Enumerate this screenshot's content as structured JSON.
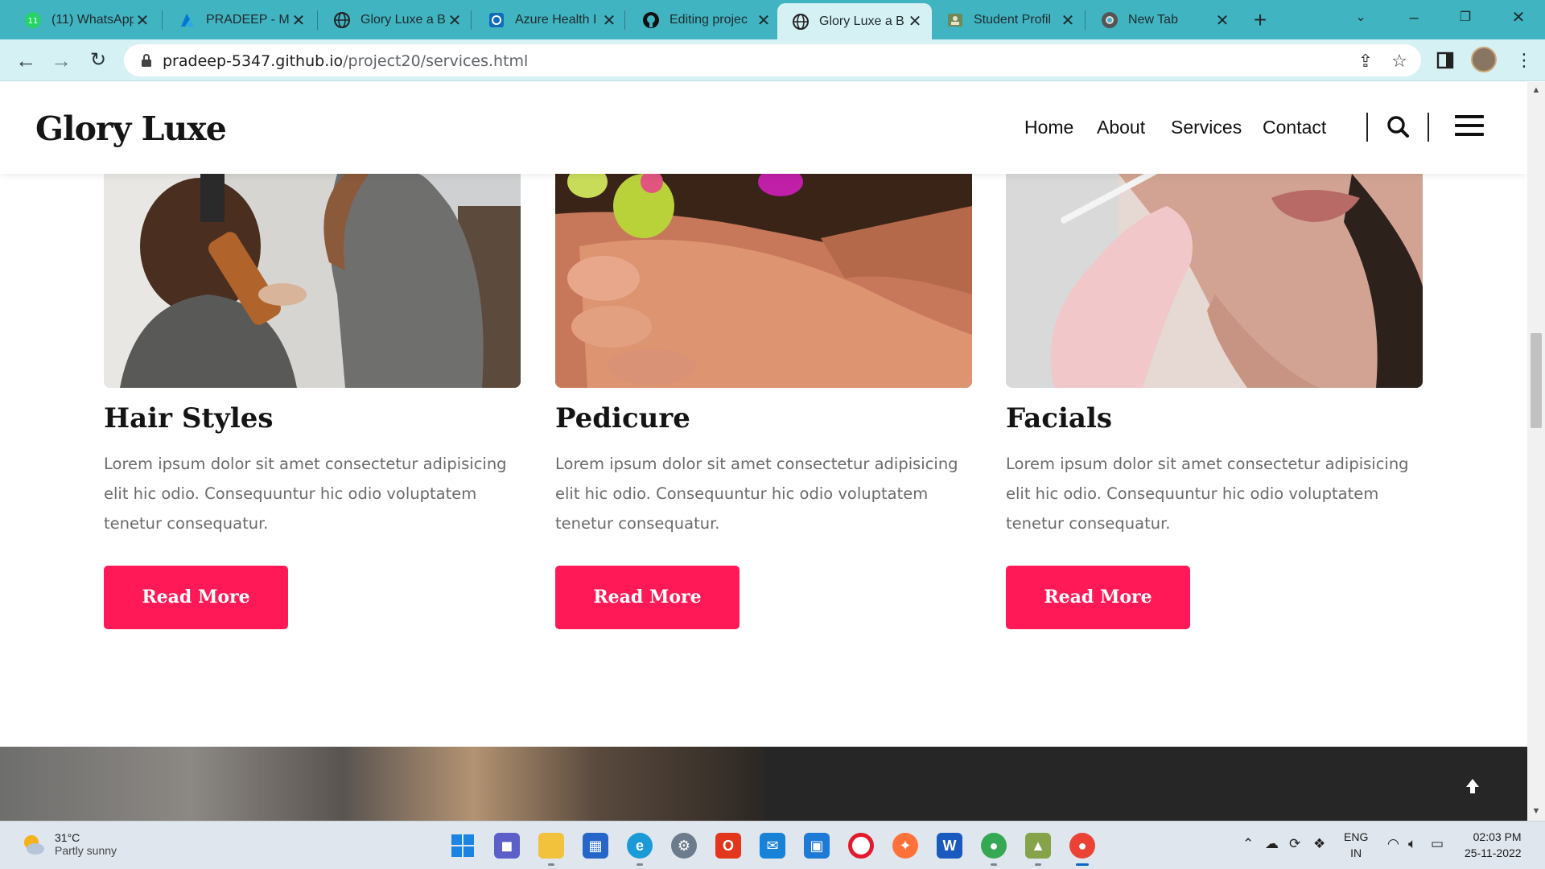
{
  "browser": {
    "tabs": [
      {
        "title": "(11) WhatsApp",
        "icon": "whatsapp-icon",
        "active": false
      },
      {
        "title": "PRADEEP - Mi",
        "icon": "azure-icon",
        "active": false
      },
      {
        "title": "Glory Luxe a B",
        "icon": "globe-icon",
        "active": false
      },
      {
        "title": "Azure Health I",
        "icon": "azure-health-icon",
        "active": false
      },
      {
        "title": "Editing projec",
        "icon": "github-icon",
        "active": false
      },
      {
        "title": "Glory Luxe a B",
        "icon": "globe-icon",
        "active": true
      },
      {
        "title": "Student Profil",
        "icon": "student-icon",
        "active": false
      },
      {
        "title": "New Tab",
        "icon": "chrome-icon",
        "active": false
      }
    ],
    "whatsapp_badge": "11",
    "url_host": "pradeep-5347.github.io",
    "url_path": "/project20/services.html"
  },
  "site": {
    "brand": "Glory Luxe",
    "nav": [
      "Home",
      "About",
      "Services",
      "Contact"
    ]
  },
  "services": [
    {
      "title": "Hair Styles",
      "text": "Lorem ipsum dolor sit amet consectetur adipisicing elit hic odio. Consequuntur hic odio voluptatem tenetur consequatur.",
      "button": "Read More",
      "image": "hair-styling-photo"
    },
    {
      "title": "Pedicure",
      "text": "Lorem ipsum dolor sit amet consectetur adipisicing elit hic odio. Consequuntur hic odio voluptatem tenetur consequatur.",
      "button": "Read More",
      "image": "pedicure-photo"
    },
    {
      "title": "Facials",
      "text": "Lorem ipsum dolor sit amet consectetur adipisicing elit hic odio. Consequuntur hic odio voluptatem tenetur consequatur.",
      "button": "Read More",
      "image": "facial-photo"
    }
  ],
  "colors": {
    "accent": "#ff1a57",
    "tabbar": "#41b4c1",
    "toolbar": "#d6f1f4"
  },
  "taskbar": {
    "weather_temp": "31°C",
    "weather_cond": "Partly sunny",
    "lang_top": "ENG",
    "lang_bottom": "IN",
    "time": "02:03 PM",
    "date": "25-11-2022"
  }
}
